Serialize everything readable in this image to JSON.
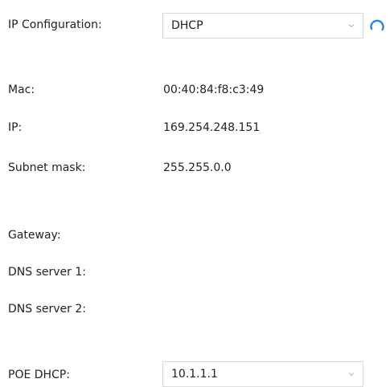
{
  "ip_configuration": {
    "label": "IP Configuration:",
    "selected": "DHCP"
  },
  "network_info": {
    "mac_label": "Mac:",
    "mac_value": "00:40:84:f8:c3:49",
    "ip_label": "IP:",
    "ip_value": "169.254.248.151",
    "subnet_label": "Subnet mask:",
    "subnet_value": "255.255.0.0",
    "gateway_label": "Gateway:",
    "dns1_label": "DNS server 1:",
    "dns2_label": "DNS server 2:"
  },
  "poe_dhcp": {
    "label": "POE DHCP:",
    "selected": "10.1.1.1"
  },
  "icons": {
    "select_chevron": "chevron-down-icon",
    "loading": "spinner-icon"
  },
  "colors": {
    "spinner": "#1e88e5",
    "select_border": "#d9d9d9",
    "text": "#222222"
  }
}
